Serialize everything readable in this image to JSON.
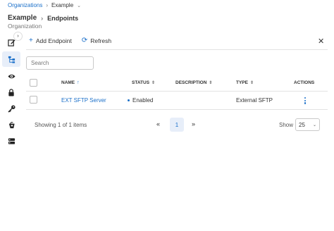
{
  "breadcrumb": {
    "root": "Organizations",
    "separator": "›",
    "current": "Example",
    "caret": "⌄"
  },
  "header": {
    "title": "Example",
    "separator": "›",
    "section": "Endpoints",
    "subtitle": "Organization"
  },
  "sidebar": {
    "collapse_glyph": "›",
    "items": [
      {
        "icon": "edit-icon",
        "active": false
      },
      {
        "icon": "hierarchy-icon",
        "active": true
      },
      {
        "icon": "eye-icon",
        "active": false
      },
      {
        "icon": "lock-icon",
        "active": false
      },
      {
        "icon": "key-icon",
        "active": false
      },
      {
        "icon": "bucket-icon",
        "active": false
      },
      {
        "icon": "server-icon",
        "active": false
      }
    ]
  },
  "toolbar": {
    "add_glyph": "+",
    "add_label": "Add Endpoint",
    "refresh_glyph": "⟳",
    "refresh_label": "Refresh",
    "close_glyph": "✕"
  },
  "search": {
    "placeholder": "Search"
  },
  "table": {
    "columns": {
      "name": "NAME",
      "name_sort": "↑",
      "status": "STATUS",
      "description": "DESCRIPTION",
      "type": "TYPE",
      "actions": "ACTIONS",
      "sort_glyph": "⇕"
    },
    "rows": [
      {
        "name": "EXT SFTP Server",
        "status": "Enabled",
        "description": "",
        "type": "External SFTP"
      }
    ]
  },
  "footer": {
    "showing": "Showing 1 of 1 items",
    "prev_glyph": "«",
    "next_glyph": "»",
    "page": "1",
    "show_label": "Show",
    "page_size": "25",
    "page_size_caret": "⌄"
  },
  "colors": {
    "accent": "#1a6fc9",
    "active_bg": "#e7eef9"
  }
}
